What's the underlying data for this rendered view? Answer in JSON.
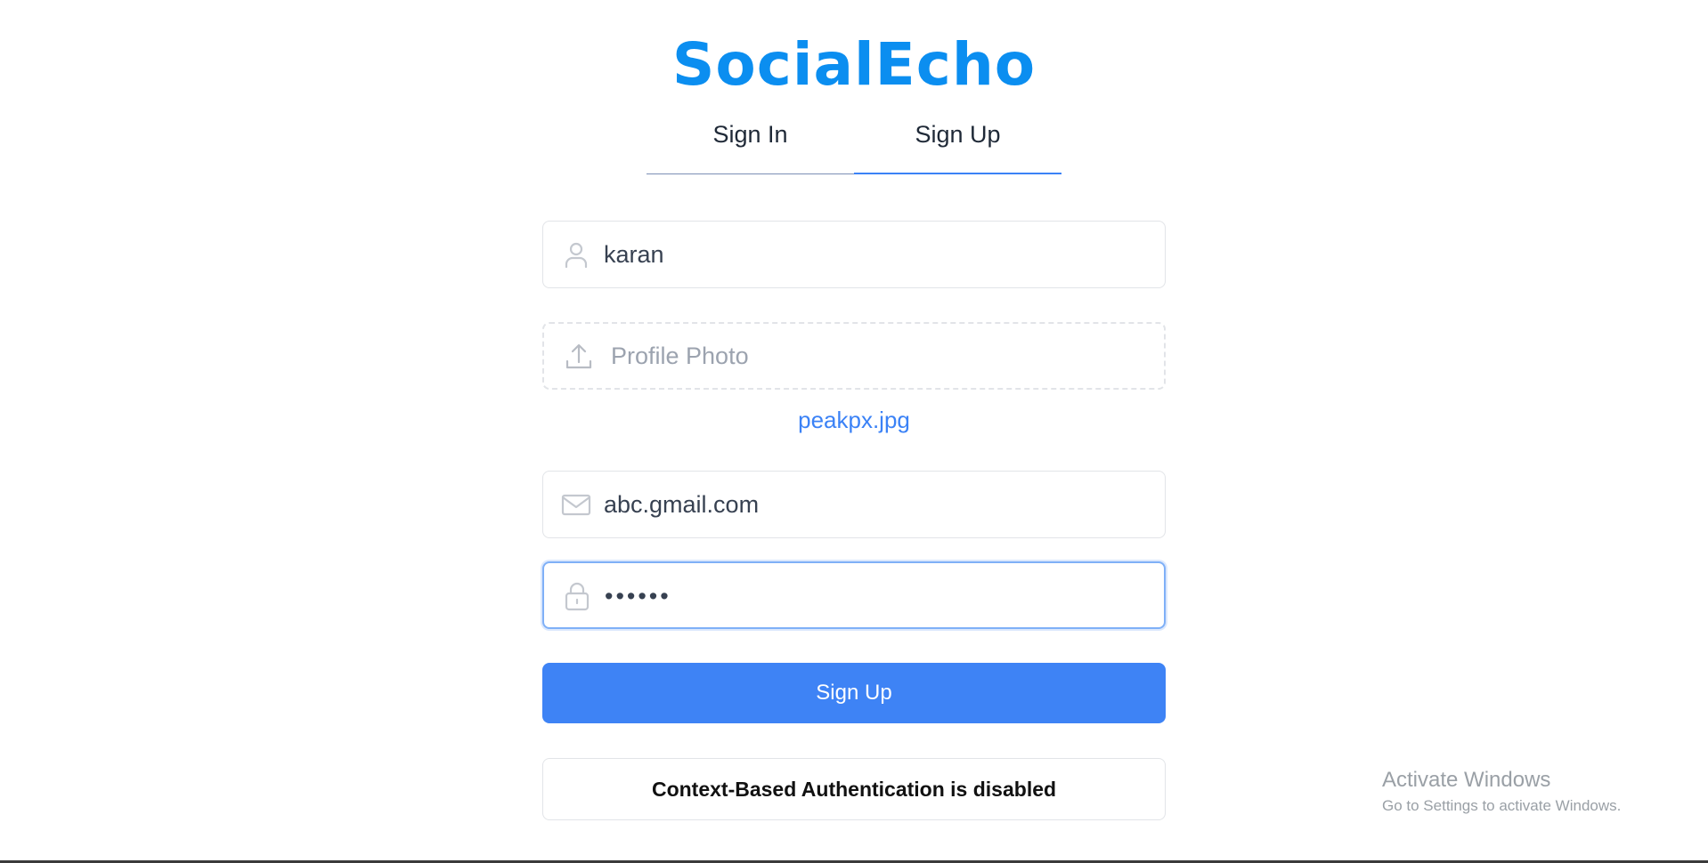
{
  "app": {
    "logo_text": "SocialEcho"
  },
  "tabs": [
    {
      "label": "Sign In",
      "active": false
    },
    {
      "label": "Sign Up",
      "active": true
    }
  ],
  "form": {
    "name": {
      "value": "karan",
      "icon": "user-icon"
    },
    "profile_photo": {
      "label": "Profile Photo",
      "icon": "upload-icon",
      "selected_file": "peakpx.jpg"
    },
    "email": {
      "value": "abc.gmail.com",
      "icon": "mail-icon"
    },
    "password": {
      "value": "••••••",
      "icon": "lock-icon"
    },
    "submit_label": "Sign Up"
  },
  "notice": {
    "text": "Context-Based Authentication is disabled"
  },
  "watermark": {
    "line1": "Activate Windows",
    "line2": "Go to Settings to activate Windows."
  },
  "colors": {
    "brand": "#0b8ef0",
    "accent": "#3e83f5",
    "link": "#3b82f6"
  }
}
